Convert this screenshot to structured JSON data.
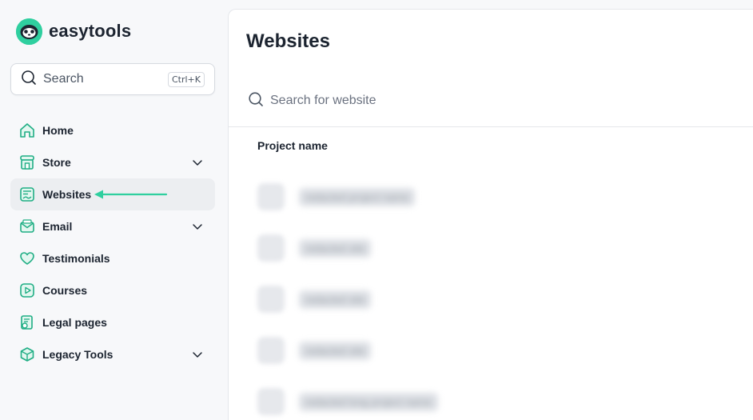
{
  "brand": {
    "name": "easytools",
    "accent": "#2fcf9f"
  },
  "search": {
    "label": "Search",
    "shortcut": "Ctrl+K"
  },
  "nav": {
    "items": [
      {
        "label": "Home",
        "icon": "home-icon"
      },
      {
        "label": "Store",
        "icon": "store-icon",
        "expandable": true
      },
      {
        "label": "Websites",
        "icon": "websites-icon",
        "active": true
      },
      {
        "label": "Email",
        "icon": "email-icon",
        "expandable": true
      },
      {
        "label": "Testimonials",
        "icon": "heart-icon"
      },
      {
        "label": "Courses",
        "icon": "play-icon"
      },
      {
        "label": "Legal pages",
        "icon": "legal-icon"
      },
      {
        "label": "Legacy Tools",
        "icon": "box-icon",
        "expandable": true
      }
    ]
  },
  "main": {
    "title": "Websites",
    "search_placeholder": "Search for website",
    "table": {
      "column": "Project name",
      "rows": [
        {
          "name": "redacted project name"
        },
        {
          "name": "redacted site"
        },
        {
          "name": "redacted site"
        },
        {
          "name": "redacted site"
        },
        {
          "name": "redacted long project name"
        }
      ]
    }
  }
}
